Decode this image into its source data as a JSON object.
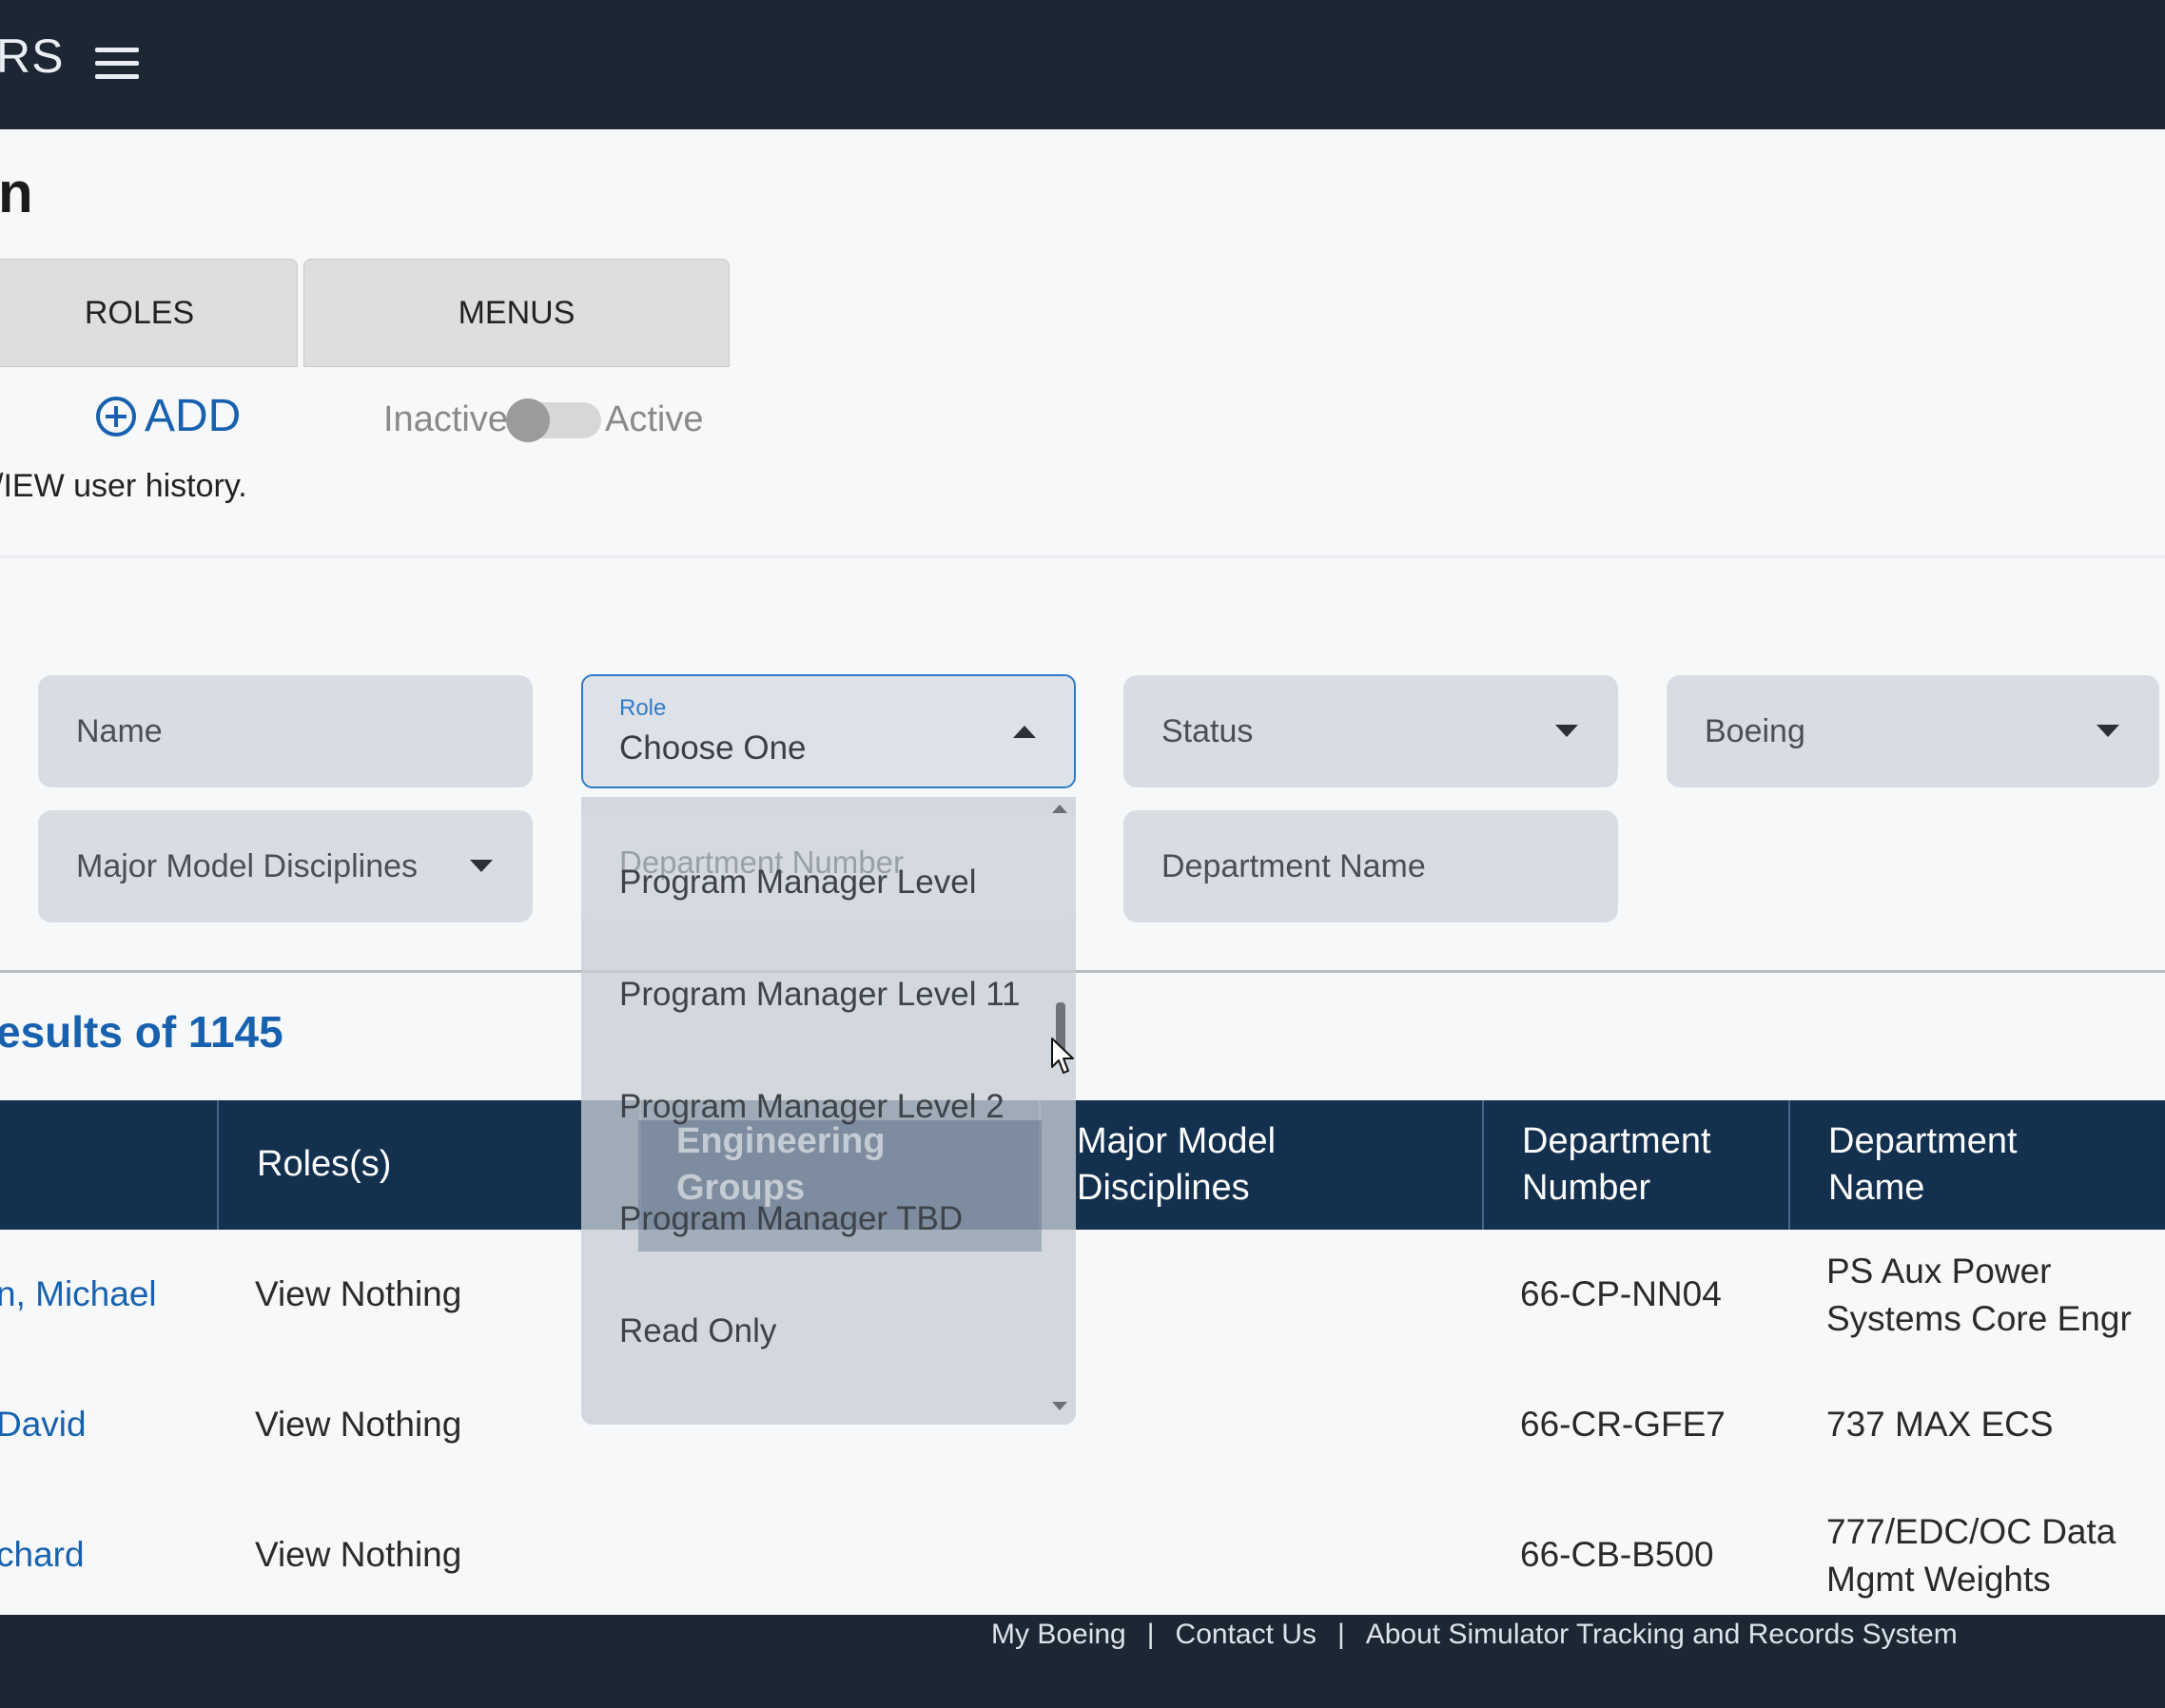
{
  "header": {
    "app_abbr": "RS"
  },
  "page": {
    "title": "n"
  },
  "tabs": [
    {
      "label": "ROLES"
    },
    {
      "label": "MENUS"
    }
  ],
  "actions": {
    "add_label": "ADD",
    "toggle_off": "Inactive",
    "toggle_on": "Active",
    "history_text": "/IEW user history."
  },
  "filters": {
    "name_placeholder": "Name",
    "role_label": "Role",
    "role_value": "Choose One",
    "status_placeholder": "Status",
    "company_value": "Boeing",
    "mmd_placeholder": "Major Model Disciplines",
    "dept_number_placeholder": "Department Number",
    "dept_name_placeholder": "Department Name"
  },
  "role_dropdown": {
    "options": [
      "Program Manager Level",
      "Program Manager Level 11",
      "Program Manager Level 2",
      "Program Manager TBD",
      "Read Only"
    ]
  },
  "results": {
    "text": "esults of 1145"
  },
  "table": {
    "headers": [
      "Roles(s)",
      "Engineering Groups",
      "Major Model Disciplines",
      "Department Number",
      "Department Name"
    ],
    "rows": [
      {
        "name": "n, Michael",
        "role": "View Nothing",
        "dept_number": "66-CP-NN04",
        "dept_name": "PS Aux Power Systems Core Engr"
      },
      {
        "name": "David",
        "role": "View Nothing",
        "dept_number": "66-CR-GFE7",
        "dept_name": "737 MAX ECS"
      },
      {
        "name": "chard",
        "role": "View Nothing",
        "dept_number": "66-CB-B500",
        "dept_name": "777/EDC/OC Data Mgmt Weights"
      }
    ]
  },
  "footer": {
    "links": [
      "My Boeing",
      "Contact Us",
      "About Simulator Tracking and Records System"
    ]
  },
  "colors": {
    "header_bg": "#1c2733",
    "accent": "#1761ae",
    "table_header": "#13304f"
  }
}
